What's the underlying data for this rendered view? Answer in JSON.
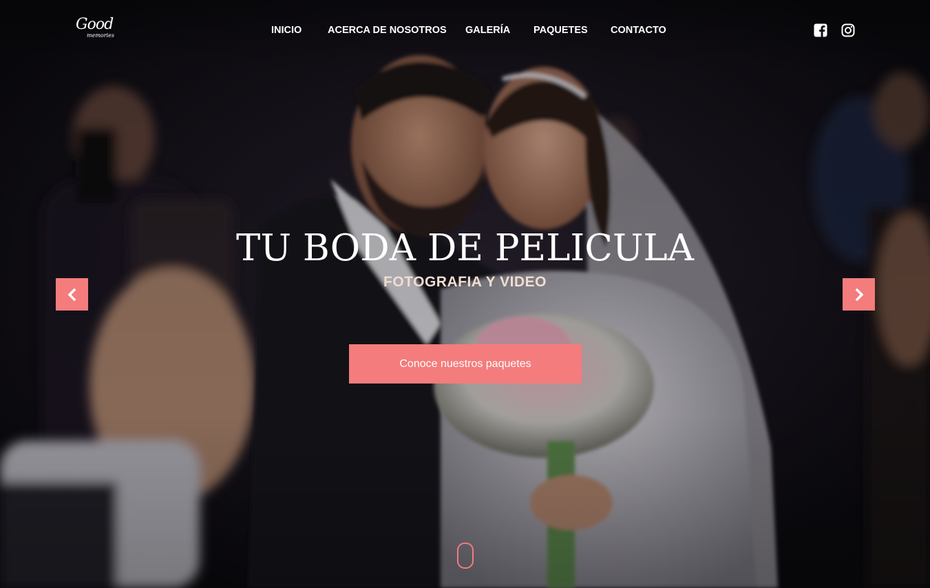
{
  "brand": {
    "logo_main": "Good",
    "logo_sub": "memories"
  },
  "nav": {
    "items": [
      {
        "label": "INICIO"
      },
      {
        "label": "ACERCA DE NOSOTROS"
      },
      {
        "label": "GALERÍA"
      },
      {
        "label": "PAQUETES"
      },
      {
        "label": "CONTACTO"
      }
    ]
  },
  "social": {
    "icons": [
      "facebook-icon",
      "instagram-icon"
    ]
  },
  "hero": {
    "title": "TU BODA DE PELICULA",
    "subtitle": "FOTOGRAFIA Y VIDEO",
    "cta_label": "Conoce nuestros paquetes"
  },
  "carousel": {
    "prev_icon": "chevron-left-icon",
    "next_icon": "chevron-right-icon"
  },
  "colors": {
    "accent": "#f47c7c",
    "text_light": "#ffffff",
    "subtitle": "#f1ddd0",
    "background": "#0d0c12"
  }
}
